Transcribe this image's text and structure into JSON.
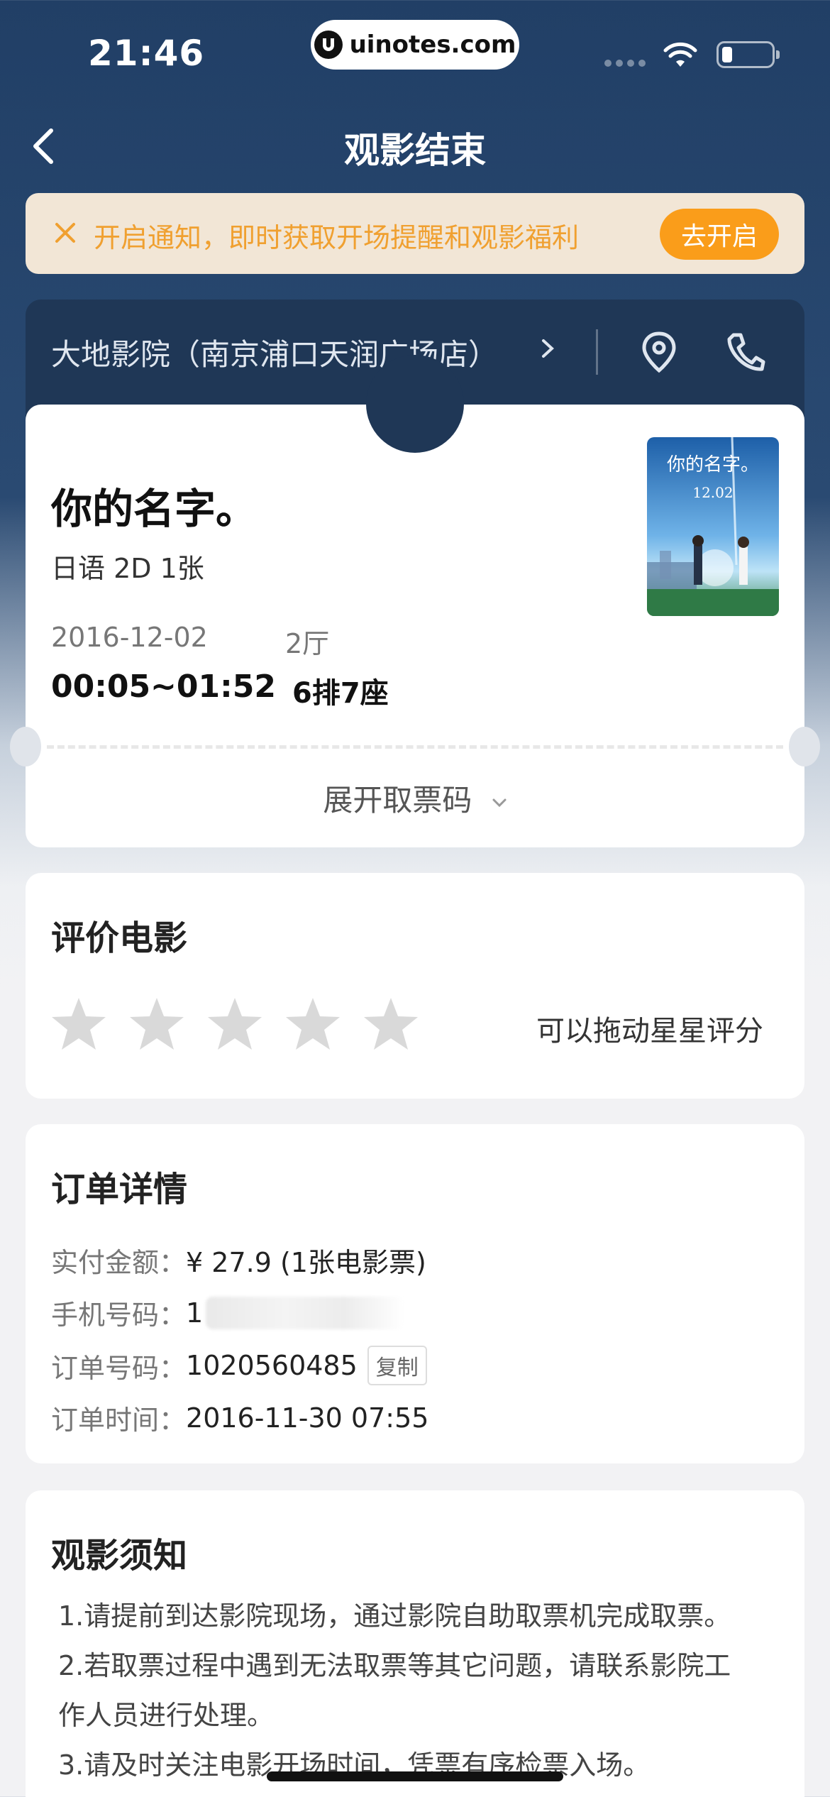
{
  "status_bar": {
    "time": "21:46",
    "url": "uinotes.com"
  },
  "nav": {
    "title": "观影结束"
  },
  "notice": {
    "text": "开启通知，即时获取开场提醒和观影福利",
    "button": "去开启",
    "accent": "#fa9d1a"
  },
  "cinema": {
    "name": "大地影院（南京浦口天润广场店）"
  },
  "ticket": {
    "movie_title": "你的名字。",
    "meta": "日语 2D 1张",
    "date": "2016-12-02",
    "hall": "2厅",
    "time": "00:05~01:52",
    "seat": "6排7座",
    "expand_label": "展开取票码"
  },
  "poster": {
    "title_text": "你的名字。",
    "date_text": "12.02"
  },
  "rating": {
    "title": "评价电影",
    "hint": "可以拖动星星评分",
    "stars": 5
  },
  "order": {
    "title": "订单详情",
    "rows": [
      {
        "label": "实付金额：",
        "value": "¥ 27.9 (1张电影票)"
      },
      {
        "label": "手机号码：",
        "value": "1"
      },
      {
        "label": "订单号码：",
        "value": "1020560485",
        "action": "复制"
      },
      {
        "label": "订单时间：",
        "value": "2016-11-30 07:55"
      }
    ]
  },
  "viewing_notice": {
    "title": "观影须知",
    "lines": [
      "1.请提前到达影院现场，通过影院自助取票机完成取票。",
      "2.若取票过程中遇到无法取票等其它问题，请联系影院工",
      "作人员进行处理。",
      "3.请及时关注电影开场时间，凭票有序检票入场。"
    ]
  }
}
